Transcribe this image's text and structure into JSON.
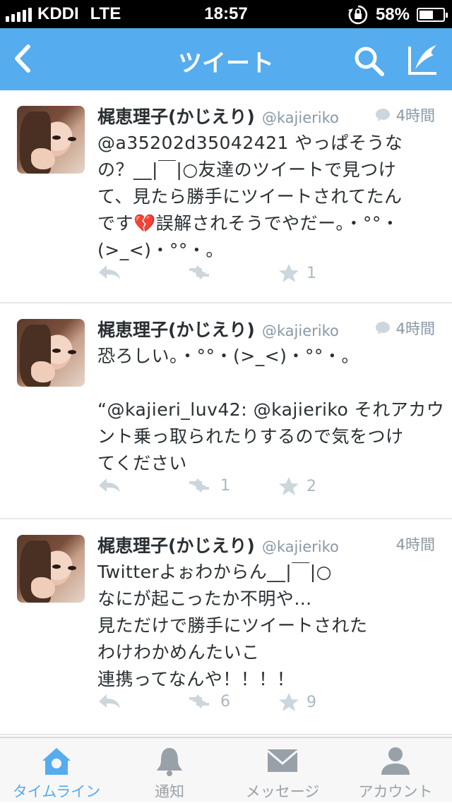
{
  "status_bar": {
    "carrier": "KDDI",
    "network": "LTE",
    "time": "18:57",
    "battery": "58%",
    "battery_level": 0.58
  },
  "nav": {
    "title": "ツイート"
  },
  "tweets": [
    {
      "name": "梶恵理子(かじえり)",
      "handle": "@kajieriko",
      "time": "4時間",
      "has_conversation_icon": true,
      "body": [
        "@a35202d35042421 やっぱそうな",
        "の？__|￣|○友達のツイートで見つけ",
        "て、見たら勝手にツイートされてたん",
        "です💔誤解されそうでやだー。・°°・",
        "(>_<)・°°・。"
      ],
      "retweets": "",
      "favorites": "1"
    },
    {
      "name": "梶恵理子(かじえり)",
      "handle": "@kajieriko",
      "time": "4時間",
      "has_conversation_icon": true,
      "body": [
        "恐ろしい。・°°・(>_<)・°°・。",
        "",
        "“@kajieri_luv42: @kajieriko それアカウ",
        "ント乗っ取られたりするので気をつけ",
        "てください"
      ],
      "retweets": "1",
      "favorites": "2"
    },
    {
      "name": "梶恵理子(かじえり)",
      "handle": "@kajieriko",
      "time": "4時間",
      "has_conversation_icon": false,
      "body": [
        "Twitterよぉわからん__|￣|○",
        "なにが起こったか不明や…",
        "見ただけで勝手にツイートされた",
        "わけわかめんたいこ",
        "連携ってなんや！！！！"
      ],
      "retweets": "6",
      "favorites": "9"
    }
  ],
  "tabbar": {
    "items": [
      {
        "label": "タイムライン",
        "icon": "home-icon",
        "active": true
      },
      {
        "label": "通知",
        "icon": "bell-icon",
        "active": false
      },
      {
        "label": "メッセージ",
        "icon": "envelope-icon",
        "active": false
      },
      {
        "label": "アカウント",
        "icon": "person-icon",
        "active": false
      }
    ]
  },
  "colors": {
    "accent": "#55acee",
    "meta_gray": "#8899a6",
    "action_gray": "#aab8c2"
  }
}
